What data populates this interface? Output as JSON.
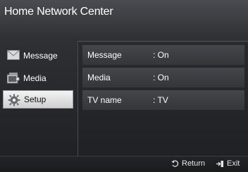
{
  "window": {
    "title": "Home Network Center"
  },
  "sidebar": {
    "items": [
      {
        "label": "Message",
        "icon": "envelope-icon"
      },
      {
        "label": "Media",
        "icon": "media-film-icon"
      },
      {
        "label": "Setup",
        "icon": "gear-icon",
        "selected": true
      }
    ]
  },
  "settings": {
    "rows": [
      {
        "label": "Message",
        "value": ": On"
      },
      {
        "label": "Media",
        "value": ": On"
      },
      {
        "label": "TV name",
        "value": ": TV"
      }
    ]
  },
  "footer": {
    "return_label": "Return",
    "exit_label": "Exit"
  },
  "colors": {
    "background": "#1f2023",
    "selected_item_bg": "#e6e6e6",
    "row_bg": "#3d3e42",
    "text": "#ffffff"
  }
}
